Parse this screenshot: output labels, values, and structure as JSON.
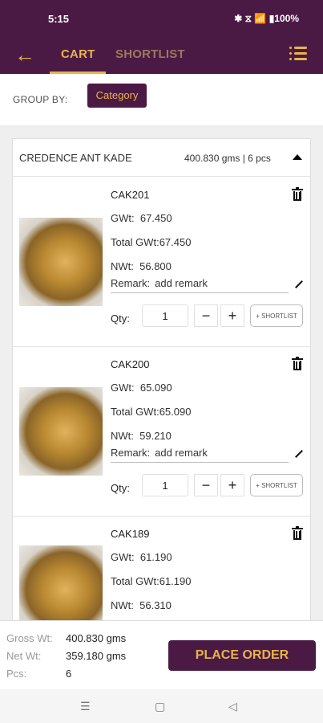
{
  "statusbar": {
    "time": "5:15",
    "icons_text": "✱ ⧖ 📶 ▮100%"
  },
  "topbar": {
    "tabs": [
      "CART",
      "SHORTLIST"
    ]
  },
  "group": {
    "label": "GROUP BY:",
    "button": "Category"
  },
  "card": {
    "name": "CREDENCE ANT KADE",
    "summary": "400.830 gms | 6 pcs",
    "items": [
      {
        "code": "CAK201",
        "gwt_label": "GWt:",
        "gwt": "67.450",
        "total_label": "Total GWt:",
        "total": "67.450",
        "nwt_label": "NWt:",
        "nwt": "56.800",
        "remark_label": "Remark:",
        "remark_placeholder": "add remark",
        "qty_label": "Qty:",
        "qty": "1",
        "shortlist": "+ SHORTLIST"
      },
      {
        "code": "CAK200",
        "gwt_label": "GWt:",
        "gwt": "65.090",
        "total_label": "Total GWt:",
        "total": "65.090",
        "nwt_label": "NWt:",
        "nwt": "59.210",
        "remark_label": "Remark:",
        "remark_placeholder": "add remark",
        "qty_label": "Qty:",
        "qty": "1",
        "shortlist": "+ SHORTLIST"
      },
      {
        "code": "CAK189",
        "gwt_label": "GWt:",
        "gwt": "61.190",
        "total_label": "Total GWt:",
        "total": "61.190",
        "nwt_label": "NWt:",
        "nwt": "56.310"
      }
    ]
  },
  "footer": {
    "gross_label": "Gross Wt:",
    "gross": "400.830 gms",
    "net_label": "Net Wt:",
    "net": "359.180 gms",
    "pcs_label": "Pcs:",
    "pcs": "6",
    "place_order": "PLACE ORDER"
  },
  "nav": {
    "recents": "☰",
    "home": "▢",
    "back": "◁"
  }
}
